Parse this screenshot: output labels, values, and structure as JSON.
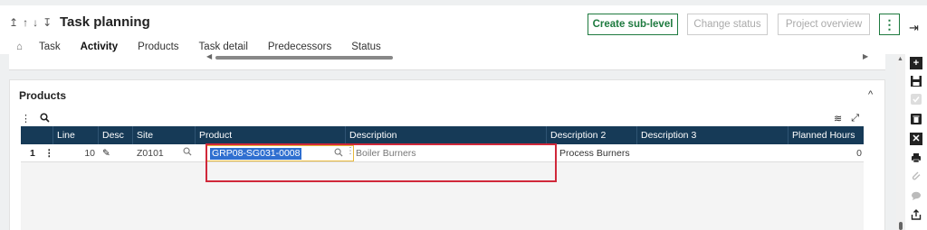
{
  "header": {
    "title": "Task planning",
    "nav_icons": [
      "↥",
      "↑",
      "↓",
      "↧"
    ],
    "buttons": {
      "create_sub_level": "Create sub-level",
      "change_status": "Change status",
      "project_overview": "Project overview",
      "more": "⋮"
    },
    "logout_icon": "⇥"
  },
  "tabs": {
    "home_icon": "⌂",
    "items": [
      "Task",
      "Activity",
      "Products",
      "Task detail",
      "Predecessors",
      "Status"
    ],
    "active": "Activity"
  },
  "products_section": {
    "title": "Products",
    "collapse_icon": "^",
    "toolbar": {
      "menu_icon": "⋮",
      "search_icon": "🔍",
      "layers_icon": "≋",
      "expand_icon": "⤢"
    },
    "columns": [
      "Line",
      "Desc",
      "Site",
      "Product",
      "Description",
      "Description 2",
      "Description 3",
      "Planned Hours"
    ],
    "rows": [
      {
        "row_num": "1",
        "menu": "⋮",
        "line": "10",
        "desc_icon": "✎",
        "site": "Z0101",
        "product": "GRP08-SG031-0008",
        "description": "Boiler Burners",
        "description2": "Process Burners",
        "description3": "",
        "planned_hours": "0"
      }
    ]
  },
  "right_toolbar": {
    "icons": [
      "plus-icon",
      "save-icon",
      "check-icon",
      "trash-icon",
      "close-icon",
      "print-icon",
      "attach-icon",
      "comment-icon",
      "share-icon"
    ]
  },
  "colors": {
    "accent": "#1e7a3f",
    "grid_header": "#163a57",
    "highlight": "#d0283a",
    "selection": "#2f6fd0",
    "focus_border": "#e8b93b"
  }
}
